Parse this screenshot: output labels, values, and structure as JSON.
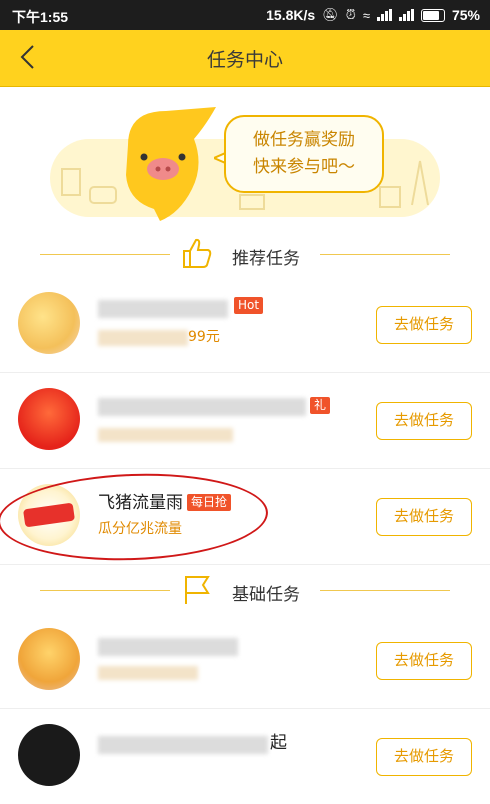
{
  "status_bar": {
    "time": "下午1:55",
    "network_speed": "15.8K/s",
    "battery": "75%"
  },
  "header": {
    "title": "任务中心",
    "back_icon": "chevron-left-icon"
  },
  "banner": {
    "bubble_line1": "做任务赢奖励",
    "bubble_line2": "快来参与吧～"
  },
  "sections": {
    "recommended": "推荐任务",
    "basic": "基础任务"
  },
  "tasks": [
    {
      "title": "",
      "badge": "Hot",
      "subtitle": "99元",
      "button": "去做任务"
    },
    {
      "title": "",
      "badge": "礼",
      "subtitle": "",
      "button": "去做任务"
    },
    {
      "title": "飞猪流量雨",
      "badge": "每日抢",
      "subtitle": "瓜分亿兆流量",
      "button": "去做任务"
    },
    {
      "title": "",
      "badge": "",
      "subtitle": "",
      "button": "去做任务"
    },
    {
      "title": "起",
      "badge": "",
      "subtitle": "",
      "button": "去做任务"
    }
  ],
  "colors": {
    "header_yellow": "#ffd21e",
    "accent_orange": "#e69a00",
    "badge_red": "#f0532a",
    "annotation_red": "#d01818"
  }
}
